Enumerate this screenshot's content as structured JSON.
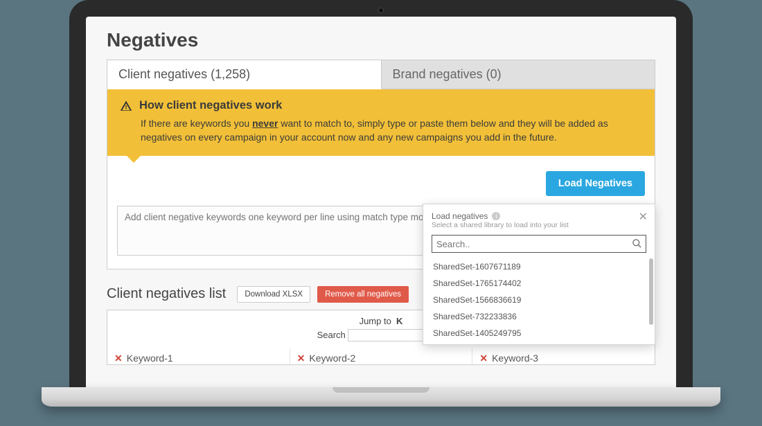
{
  "page": {
    "title": "Negatives"
  },
  "tabs": {
    "client": "Client negatives (1,258)",
    "brand": "Brand negatives (0)"
  },
  "banner": {
    "heading": "How client negatives work",
    "desc_pre": "If there are keywords you ",
    "desc_bold": "never",
    "desc_post": " want to match to, simply type or paste them below and they will be added as negatives on every campaign in your account now and any new campaigns you add in the future."
  },
  "actions": {
    "load_negatives": "Load Negatives",
    "textarea_placeholder": "Add client negative keywords one keyword per line using match type modifiers",
    "download_xlsx": "Download XLSX",
    "remove_all": "Remove all negatives"
  },
  "list": {
    "title": "Client negatives list",
    "jump_label": "Jump to",
    "jump_letter": "K",
    "search_label": "Search",
    "keywords": [
      "Keyword-1",
      "Keyword-2",
      "Keyword-3"
    ]
  },
  "popup": {
    "title": "Load negatives",
    "subtitle": "Select a shared library to load into your list",
    "search_placeholder": "Search..",
    "items": [
      "SharedSet-1607671189",
      "SharedSet-1765174402",
      "SharedSet-1566836619",
      "SharedSet-732233836",
      "SharedSet-1405249795"
    ]
  }
}
